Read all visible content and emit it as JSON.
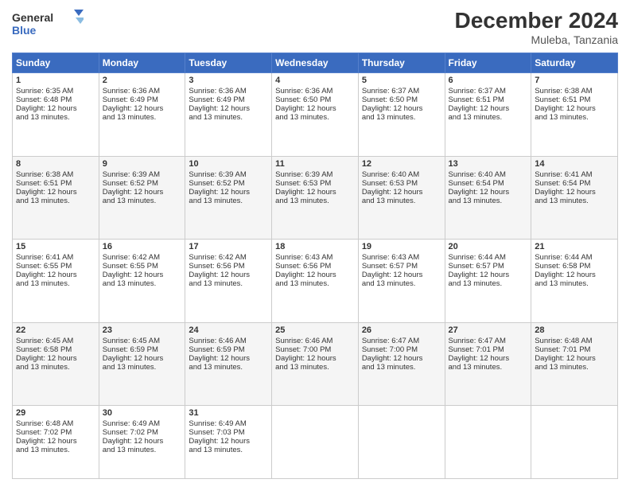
{
  "logo": {
    "line1": "General",
    "line2": "Blue"
  },
  "title": "December 2024",
  "subtitle": "Muleba, Tanzania",
  "days_of_week": [
    "Sunday",
    "Monday",
    "Tuesday",
    "Wednesday",
    "Thursday",
    "Friday",
    "Saturday"
  ],
  "weeks": [
    [
      {
        "day": "1",
        "sunrise": "6:35 AM",
        "sunset": "6:48 PM",
        "daylight": "12 hours and 13 minutes."
      },
      {
        "day": "2",
        "sunrise": "6:36 AM",
        "sunset": "6:49 PM",
        "daylight": "12 hours and 13 minutes."
      },
      {
        "day": "3",
        "sunrise": "6:36 AM",
        "sunset": "6:49 PM",
        "daylight": "12 hours and 13 minutes."
      },
      {
        "day": "4",
        "sunrise": "6:36 AM",
        "sunset": "6:50 PM",
        "daylight": "12 hours and 13 minutes."
      },
      {
        "day": "5",
        "sunrise": "6:37 AM",
        "sunset": "6:50 PM",
        "daylight": "12 hours and 13 minutes."
      },
      {
        "day": "6",
        "sunrise": "6:37 AM",
        "sunset": "6:51 PM",
        "daylight": "12 hours and 13 minutes."
      },
      {
        "day": "7",
        "sunrise": "6:38 AM",
        "sunset": "6:51 PM",
        "daylight": "12 hours and 13 minutes."
      }
    ],
    [
      {
        "day": "8",
        "sunrise": "6:38 AM",
        "sunset": "6:51 PM",
        "daylight": "12 hours and 13 minutes."
      },
      {
        "day": "9",
        "sunrise": "6:39 AM",
        "sunset": "6:52 PM",
        "daylight": "12 hours and 13 minutes."
      },
      {
        "day": "10",
        "sunrise": "6:39 AM",
        "sunset": "6:52 PM",
        "daylight": "12 hours and 13 minutes."
      },
      {
        "day": "11",
        "sunrise": "6:39 AM",
        "sunset": "6:53 PM",
        "daylight": "12 hours and 13 minutes."
      },
      {
        "day": "12",
        "sunrise": "6:40 AM",
        "sunset": "6:53 PM",
        "daylight": "12 hours and 13 minutes."
      },
      {
        "day": "13",
        "sunrise": "6:40 AM",
        "sunset": "6:54 PM",
        "daylight": "12 hours and 13 minutes."
      },
      {
        "day": "14",
        "sunrise": "6:41 AM",
        "sunset": "6:54 PM",
        "daylight": "12 hours and 13 minutes."
      }
    ],
    [
      {
        "day": "15",
        "sunrise": "6:41 AM",
        "sunset": "6:55 PM",
        "daylight": "12 hours and 13 minutes."
      },
      {
        "day": "16",
        "sunrise": "6:42 AM",
        "sunset": "6:55 PM",
        "daylight": "12 hours and 13 minutes."
      },
      {
        "day": "17",
        "sunrise": "6:42 AM",
        "sunset": "6:56 PM",
        "daylight": "12 hours and 13 minutes."
      },
      {
        "day": "18",
        "sunrise": "6:43 AM",
        "sunset": "6:56 PM",
        "daylight": "12 hours and 13 minutes."
      },
      {
        "day": "19",
        "sunrise": "6:43 AM",
        "sunset": "6:57 PM",
        "daylight": "12 hours and 13 minutes."
      },
      {
        "day": "20",
        "sunrise": "6:44 AM",
        "sunset": "6:57 PM",
        "daylight": "12 hours and 13 minutes."
      },
      {
        "day": "21",
        "sunrise": "6:44 AM",
        "sunset": "6:58 PM",
        "daylight": "12 hours and 13 minutes."
      }
    ],
    [
      {
        "day": "22",
        "sunrise": "6:45 AM",
        "sunset": "6:58 PM",
        "daylight": "12 hours and 13 minutes."
      },
      {
        "day": "23",
        "sunrise": "6:45 AM",
        "sunset": "6:59 PM",
        "daylight": "12 hours and 13 minutes."
      },
      {
        "day": "24",
        "sunrise": "6:46 AM",
        "sunset": "6:59 PM",
        "daylight": "12 hours and 13 minutes."
      },
      {
        "day": "25",
        "sunrise": "6:46 AM",
        "sunset": "7:00 PM",
        "daylight": "12 hours and 13 minutes."
      },
      {
        "day": "26",
        "sunrise": "6:47 AM",
        "sunset": "7:00 PM",
        "daylight": "12 hours and 13 minutes."
      },
      {
        "day": "27",
        "sunrise": "6:47 AM",
        "sunset": "7:01 PM",
        "daylight": "12 hours and 13 minutes."
      },
      {
        "day": "28",
        "sunrise": "6:48 AM",
        "sunset": "7:01 PM",
        "daylight": "12 hours and 13 minutes."
      }
    ],
    [
      {
        "day": "29",
        "sunrise": "6:48 AM",
        "sunset": "7:02 PM",
        "daylight": "12 hours and 13 minutes."
      },
      {
        "day": "30",
        "sunrise": "6:49 AM",
        "sunset": "7:02 PM",
        "daylight": "12 hours and 13 minutes."
      },
      {
        "day": "31",
        "sunrise": "6:49 AM",
        "sunset": "7:03 PM",
        "daylight": "12 hours and 13 minutes."
      },
      null,
      null,
      null,
      null
    ]
  ],
  "labels": {
    "sunrise": "Sunrise:",
    "sunset": "Sunset:",
    "daylight": "Daylight:"
  }
}
